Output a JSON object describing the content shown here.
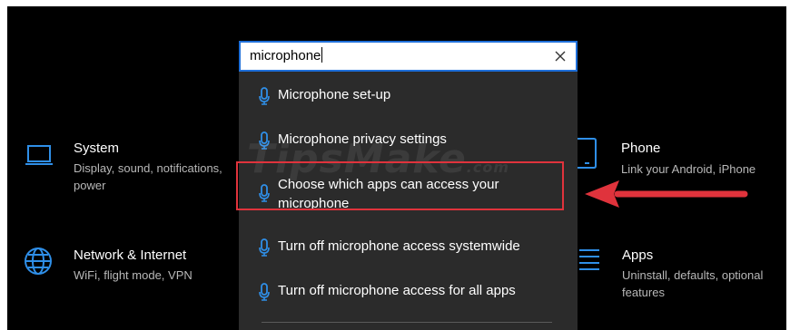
{
  "search": {
    "value": "microphone"
  },
  "results": [
    {
      "label": "Microphone set-up",
      "icon": "microphone-icon"
    },
    {
      "label": "Microphone privacy settings",
      "icon": "microphone-icon"
    },
    {
      "label": "Choose which apps can access your microphone",
      "icon": "microphone-icon"
    },
    {
      "label": "Turn off microphone access systemwide",
      "icon": "microphone-icon"
    },
    {
      "label": "Turn off microphone access for all apps",
      "icon": "microphone-icon"
    }
  ],
  "tiles": {
    "system": {
      "title": "System",
      "desc": "Display, sound, notifications, power",
      "icon": "laptop-icon"
    },
    "network": {
      "title": "Network & Internet",
      "desc": "WiFi, flight mode, VPN",
      "icon": "globe-icon"
    },
    "phone": {
      "title": "Phone",
      "desc": "Link your Android, iPhone",
      "icon": "phone-icon"
    },
    "apps": {
      "title": "Apps",
      "desc": "Uninstall, defaults, optional features",
      "icon": "apps-list-icon"
    }
  },
  "watermark": {
    "text": "TipsMake",
    "suffix": ".com"
  },
  "colors": {
    "accent": "#1e6fd9",
    "icon_blue": "#2f8fe8",
    "highlight": "#e0333c",
    "panel": "#2b2b2b"
  }
}
